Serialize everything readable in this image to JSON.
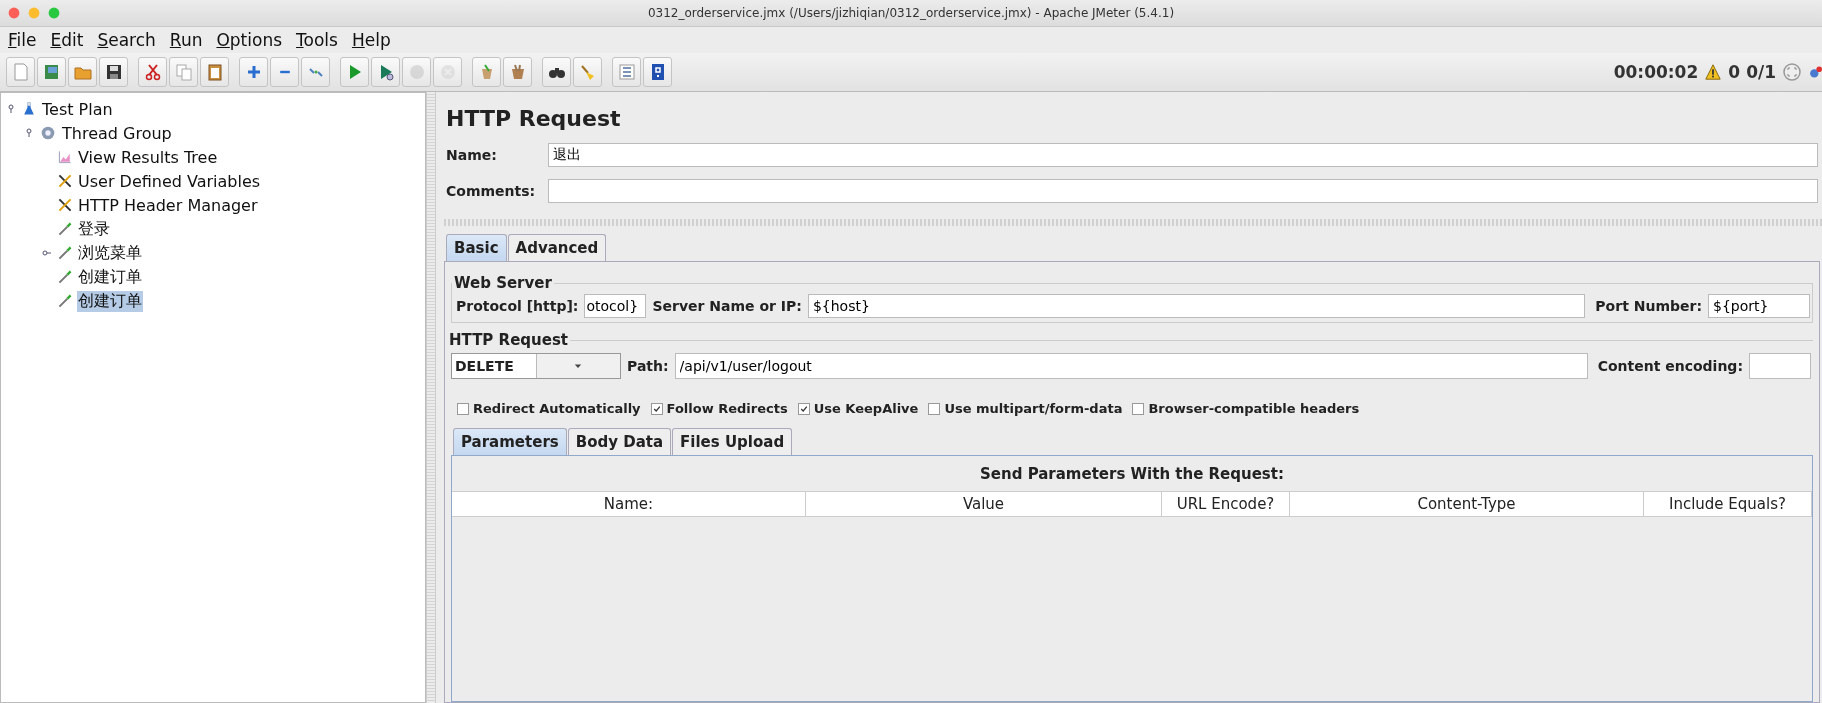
{
  "window": {
    "title": "0312_orderservice.jmx (/Users/jizhiqian/0312_orderservice.jmx) - Apache JMeter (5.4.1)"
  },
  "menu": [
    "File",
    "Edit",
    "Search",
    "Run",
    "Options",
    "Tools",
    "Help"
  ],
  "toolbar": [
    {
      "kind": "new",
      "disabled": false
    },
    {
      "kind": "templates",
      "disabled": false
    },
    {
      "kind": "open",
      "disabled": false
    },
    {
      "kind": "save",
      "disabled": false
    },
    {
      "kind": "cut",
      "disabled": false
    },
    {
      "kind": "copy",
      "disabled": false
    },
    {
      "kind": "paste",
      "disabled": false
    },
    {
      "kind": "expand",
      "disabled": false
    },
    {
      "kind": "collapse",
      "disabled": false
    },
    {
      "kind": "toggle",
      "disabled": false
    },
    {
      "kind": "start",
      "disabled": false
    },
    {
      "kind": "start_no_timers",
      "disabled": false
    },
    {
      "kind": "stop",
      "disabled": true
    },
    {
      "kind": "shutdown",
      "disabled": true
    },
    {
      "kind": "clear",
      "disabled": false
    },
    {
      "kind": "clear_all",
      "disabled": false
    },
    {
      "kind": "search",
      "disabled": false
    },
    {
      "kind": "reset_search",
      "disabled": false
    },
    {
      "kind": "functions",
      "disabled": false
    },
    {
      "kind": "help",
      "disabled": false
    }
  ],
  "status": {
    "elapsed": "00:00:02",
    "errors": "0",
    "threads": "0/1"
  },
  "tree": [
    {
      "label": "Test Plan",
      "kind": "plan",
      "expanded": true,
      "selected": false,
      "children": [
        {
          "label": "Thread Group",
          "kind": "threads",
          "expanded": true,
          "selected": false,
          "children": [
            {
              "label": "View Results Tree",
              "kind": "listener",
              "selected": false
            },
            {
              "label": "User Defined Variables",
              "kind": "config",
              "selected": false
            },
            {
              "label": "HTTP Header Manager",
              "kind": "config",
              "selected": false
            },
            {
              "label": "登录",
              "kind": "sampler",
              "selected": false
            },
            {
              "label": "浏览菜单",
              "kind": "sampler",
              "expanded": false,
              "selected": false
            },
            {
              "label": "创建订单",
              "kind": "sampler",
              "selected": false
            },
            {
              "label": "创建订单",
              "kind": "sampler",
              "selected": true
            }
          ]
        }
      ]
    }
  ],
  "element": {
    "title": "HTTP Request",
    "name_label": "Name:",
    "name": "退出",
    "comments_label": "Comments:"
  },
  "tabs": [
    {
      "label": "Basic",
      "selected": true
    },
    {
      "label": "Advanced",
      "selected": false
    }
  ],
  "web_server": {
    "legend": "Web Server",
    "protocol_label": "Protocol [http]:",
    "protocol": "otocol}",
    "server_label": "Server Name or IP:",
    "server": "${host}",
    "port_label": "Port Number:",
    "port": "${port}"
  },
  "request": {
    "legend": "HTTP Request",
    "method": "DELETE",
    "path_label": "Path:",
    "path": "/api/v1/user/logout",
    "encoding_label": "Content encoding:"
  },
  "options": [
    {
      "label": "Redirect Automatically",
      "checked": false
    },
    {
      "label": "Follow Redirects",
      "checked": true
    },
    {
      "label": "Use KeepAlive",
      "checked": true
    },
    {
      "label": "Use multipart/form-data",
      "checked": false
    },
    {
      "label": "Browser-compatible headers",
      "checked": false
    }
  ],
  "sub_tabs": [
    {
      "label": "Parameters",
      "selected": true
    },
    {
      "label": "Body Data",
      "selected": false
    },
    {
      "label": "Files Upload",
      "selected": false
    }
  ],
  "parameters": {
    "title": "Send Parameters With the Request:",
    "columns": [
      "Name:",
      "Value",
      "URL Encode?",
      "Content-Type",
      "Include Equals?"
    ]
  }
}
